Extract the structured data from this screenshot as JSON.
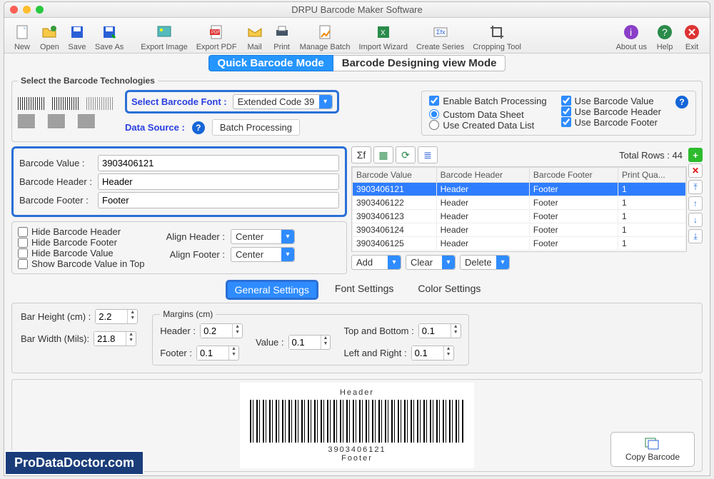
{
  "window_title": "DRPU Barcode Maker Software",
  "toolbar": [
    {
      "name": "new",
      "label": "New"
    },
    {
      "name": "open",
      "label": "Open"
    },
    {
      "name": "save",
      "label": "Save"
    },
    {
      "name": "saveas",
      "label": "Save As"
    },
    {
      "name": "exportimg",
      "label": "Export Image"
    },
    {
      "name": "exportpdf",
      "label": "Export PDF"
    },
    {
      "name": "mail",
      "label": "Mail"
    },
    {
      "name": "print",
      "label": "Print"
    },
    {
      "name": "managebatch",
      "label": "Manage Batch"
    },
    {
      "name": "importwiz",
      "label": "Import Wizard"
    },
    {
      "name": "createseries",
      "label": "Create Series"
    },
    {
      "name": "crop",
      "label": "Cropping Tool"
    }
  ],
  "toolbar_right": [
    {
      "name": "about",
      "label": "About us"
    },
    {
      "name": "help",
      "label": "Help"
    },
    {
      "name": "exit",
      "label": "Exit"
    }
  ],
  "mode_tabs": {
    "quick": "Quick Barcode Mode",
    "design": "Barcode Designing view Mode"
  },
  "tech_legend": "Select the Barcode Technologies",
  "select_font_label": "Select Barcode Font :",
  "select_font_value": "Extended Code 39",
  "data_source_label": "Data Source :",
  "data_source_value": "Batch Processing",
  "enable_batch": "Enable Batch Processing",
  "custom_sheet": "Custom Data Sheet",
  "created_list": "Use Created Data List",
  "use_value": "Use Barcode Value",
  "use_header": "Use Barcode Header",
  "use_footer": "Use Barcode Footer",
  "val_labels": {
    "value": "Barcode Value :",
    "header": "Barcode Header :",
    "footer": "Barcode Footer :"
  },
  "val_fields": {
    "value": "3903406121",
    "header": "Header",
    "footer": "Footer"
  },
  "hide_header": "Hide Barcode Header",
  "hide_footer": "Hide Barcode Footer",
  "hide_value": "Hide Barcode Value",
  "show_top": "Show Barcode Value in Top",
  "align_header_lbl": "Align Header :",
  "align_footer_lbl": "Align Footer :",
  "align_center": "Center",
  "total_rows_label": "Total Rows :",
  "total_rows_value": "44",
  "table_headers": [
    "Barcode Value",
    "Barcode Header",
    "Barcode Footer",
    "Print Qua..."
  ],
  "table_rows": [
    {
      "v": "3903406121",
      "h": "Header",
      "f": "Footer",
      "q": "1"
    },
    {
      "v": "3903406122",
      "h": "Header",
      "f": "Footer",
      "q": "1"
    },
    {
      "v": "3903406123",
      "h": "Header",
      "f": "Footer",
      "q": "1"
    },
    {
      "v": "3903406124",
      "h": "Header",
      "f": "Footer",
      "q": "1"
    },
    {
      "v": "3903406125",
      "h": "Header",
      "f": "Footer",
      "q": "1"
    }
  ],
  "row_btns": {
    "add": "Add",
    "clear": "Clear",
    "delete": "Delete"
  },
  "setting_tabs": {
    "general": "General Settings",
    "font": "Font Settings",
    "color": "Color Settings"
  },
  "bar_height_lbl": "Bar Height (cm) :",
  "bar_height": "2.2",
  "bar_width_lbl": "Bar Width (Mils):",
  "bar_width": "21.8",
  "margins_legend": "Margins (cm)",
  "m_header_lbl": "Header :",
  "m_header": "0.2",
  "m_footer_lbl": "Footer :",
  "m_footer": "0.1",
  "m_value_lbl": "Value :",
  "m_value": "0.1",
  "m_tb_lbl": "Top and Bottom :",
  "m_tb": "0.1",
  "m_lr_lbl": "Left and Right :",
  "m_lr": "0.1",
  "preview": {
    "header": "Header",
    "value": "3903406121",
    "footer": "Footer"
  },
  "copy_barcode": "Copy Barcode",
  "watermark": "ProDataDoctor.com"
}
